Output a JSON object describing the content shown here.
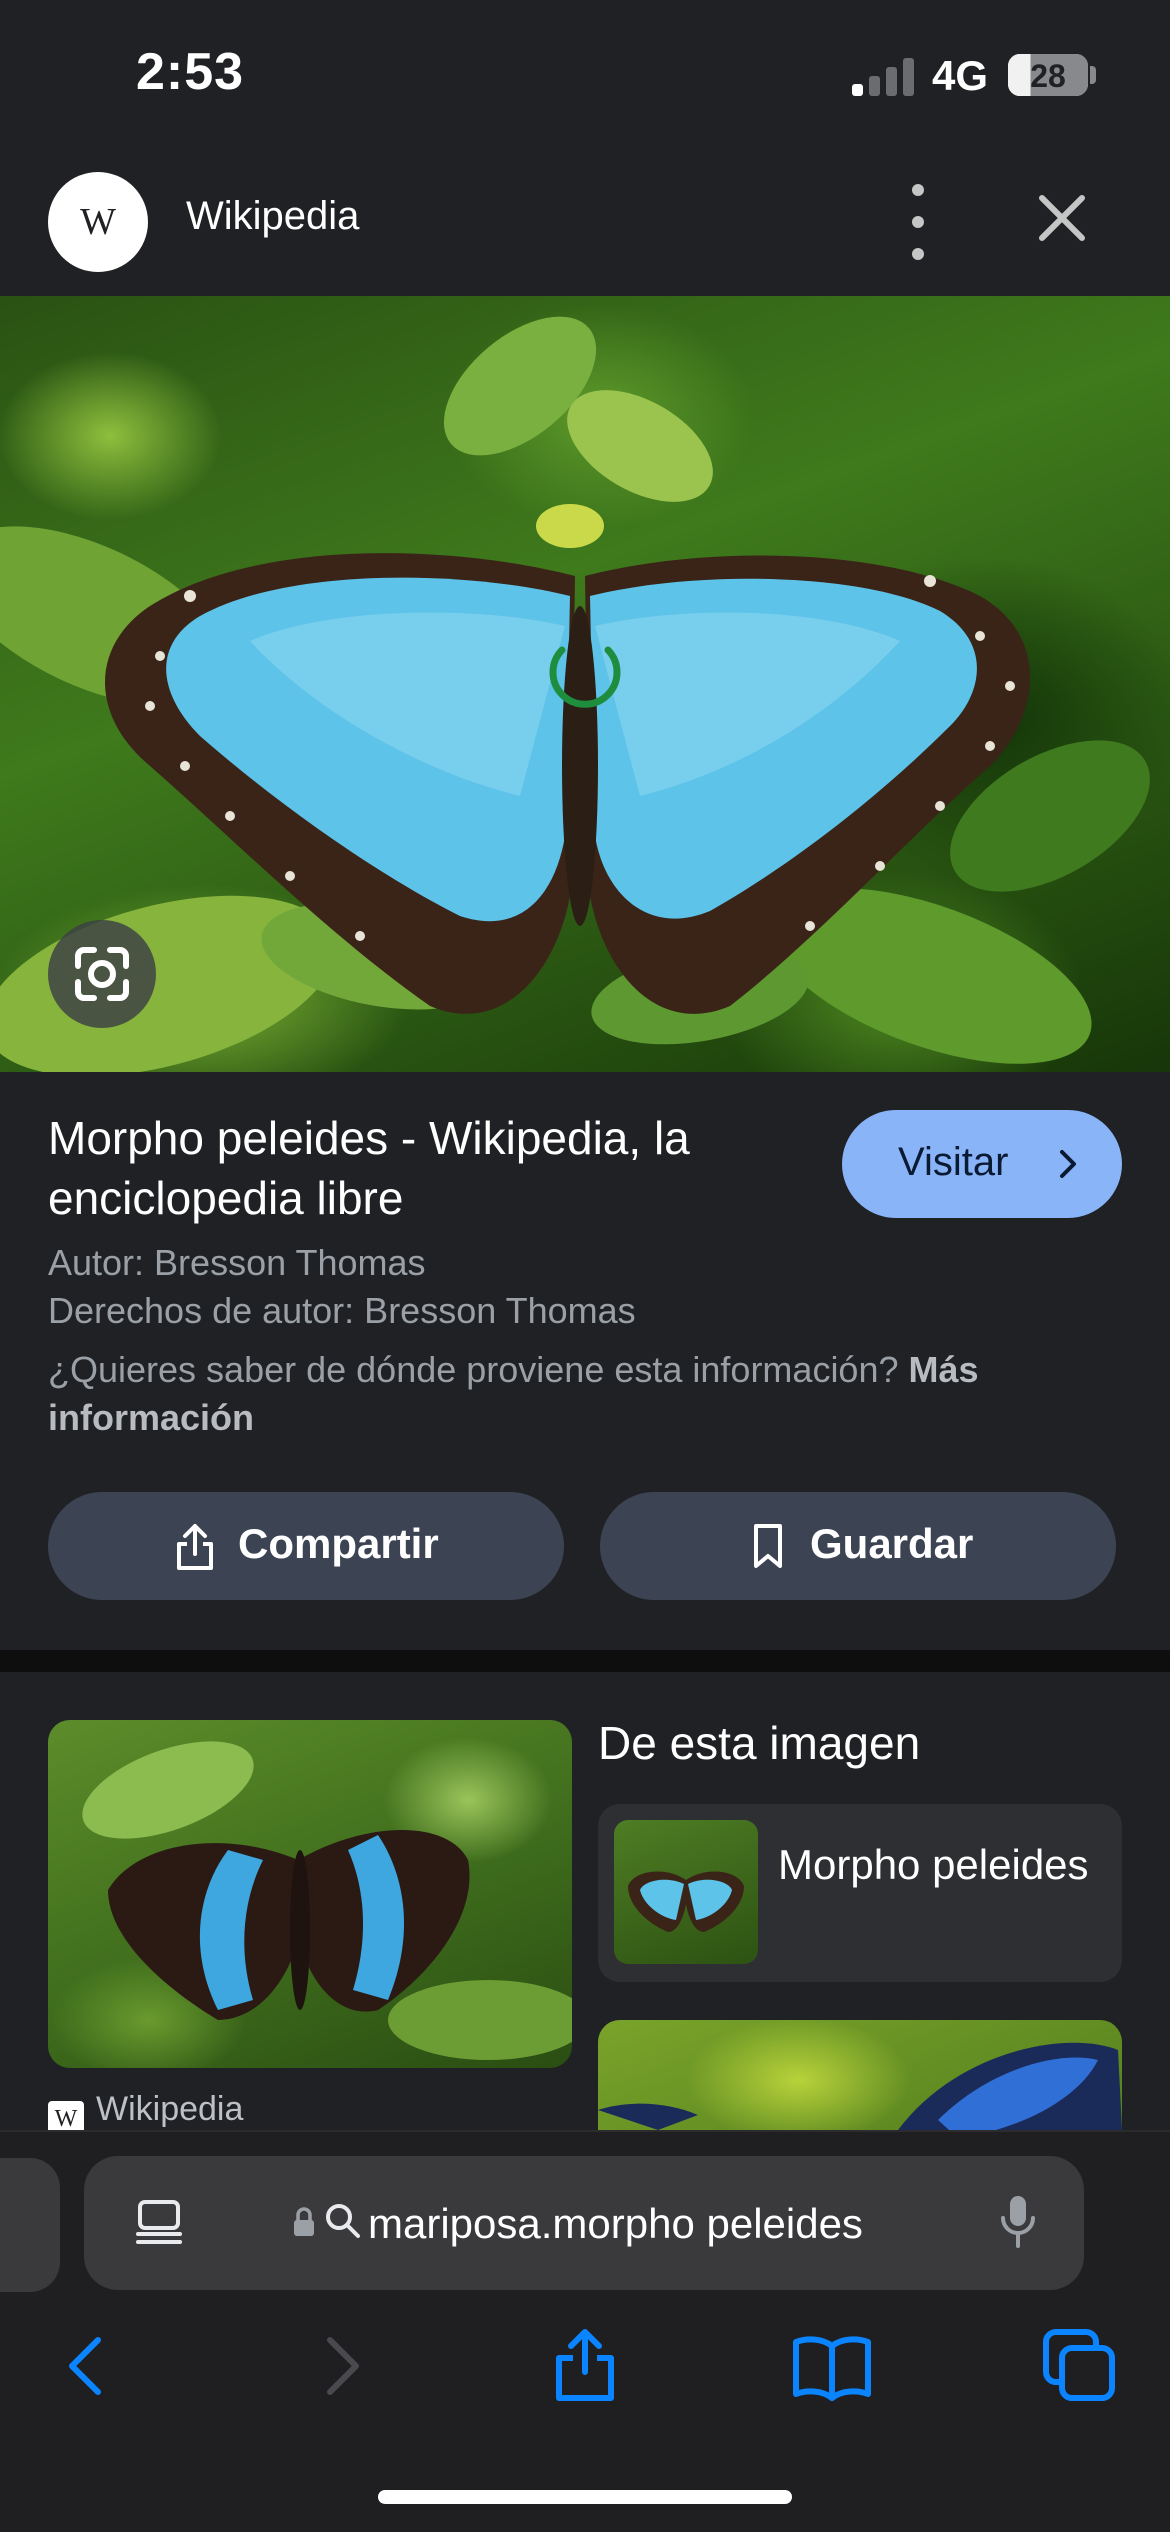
{
  "status_bar": {
    "time": "2:53",
    "network": "4G",
    "battery": "28",
    "battery_level": 0.28,
    "signal_bars_active": 1,
    "signal_bars_total": 4
  },
  "header": {
    "logo_letter": "W",
    "site_name": "Wikipedia",
    "menu_icon": "more-vert-icon",
    "close_icon": "close-icon"
  },
  "hero": {
    "image_icon": "butterfly-photo",
    "loading_icon": "spinner-icon",
    "lens_icon": "lens-search-icon"
  },
  "info": {
    "title": "Morpho peleides - Wikipedia, la enciclopedia libre",
    "visit_label": "Visitar",
    "author": "Autor: Bresson Thomas",
    "copyright": "Derechos de autor: Bresson Thomas",
    "question": "¿Quieres saber de dónde proviene esta información?",
    "more_info": "Más información",
    "share_label": "Compartir",
    "save_label": "Guardar"
  },
  "results": {
    "source_logo_letter": "W",
    "source_name": "Wikipedia",
    "from_image_title": "De esta imagen",
    "entity_name": "Morpho peleides"
  },
  "toolbar": {
    "url": "mariposa.morpho peleides",
    "icons": [
      "reader-icon",
      "lock-icon",
      "search-icon",
      "mic-icon",
      "back-icon",
      "forward-icon",
      "share-icon",
      "bookmarks-icon",
      "tabs-icon"
    ]
  },
  "colors": {
    "background": "#202124",
    "accent": "#8ab4f8",
    "pill": "#3c4454",
    "ios_blue": "#0a84ff"
  }
}
